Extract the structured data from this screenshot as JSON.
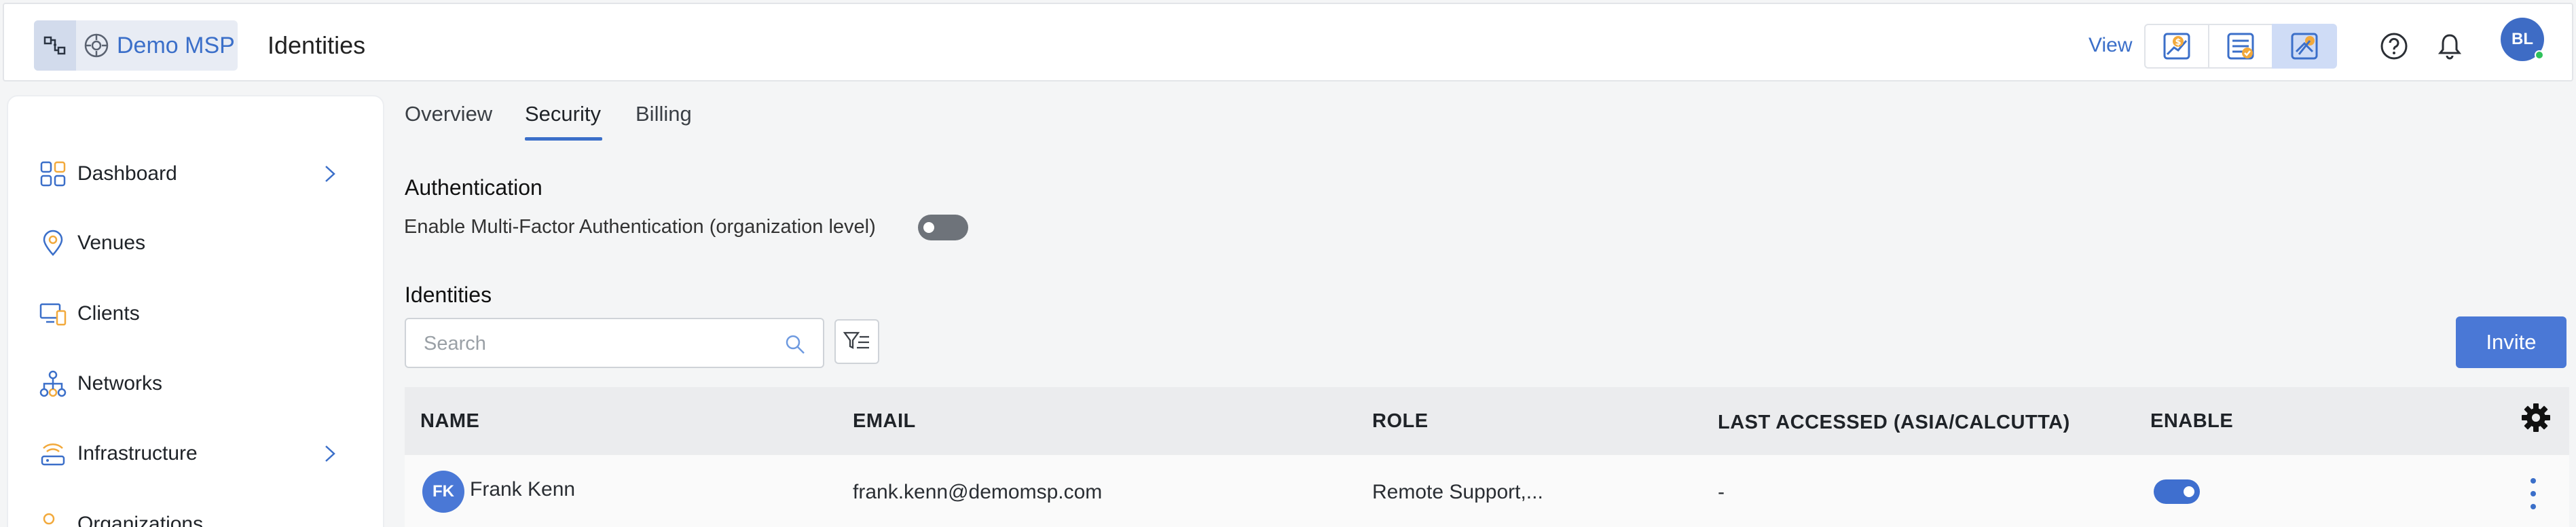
{
  "header": {
    "org_name": "Demo MSP",
    "page_title": "Identities",
    "view_label": "View",
    "avatar_initials": "BL",
    "icons": [
      "network-topology-icon",
      "org-logo-icon",
      "billing-view-icon",
      "checklist-view-icon",
      "support-view-icon",
      "help-icon",
      "bell-icon"
    ]
  },
  "sidebar": {
    "items": [
      {
        "label": "Dashboard",
        "icon": "dashboard-icon",
        "chevron": true
      },
      {
        "label": "Venues",
        "icon": "location-pin-icon",
        "chevron": false
      },
      {
        "label": "Clients",
        "icon": "devices-icon",
        "chevron": false
      },
      {
        "label": "Networks",
        "icon": "network-tree-icon",
        "chevron": false
      },
      {
        "label": "Infrastructure",
        "icon": "wifi-access-point-icon",
        "chevron": true
      },
      {
        "label": "Organizations",
        "icon": "people-icon",
        "chevron": false
      }
    ]
  },
  "tabs": [
    {
      "label": "Overview",
      "active": false
    },
    {
      "label": "Security",
      "active": true
    },
    {
      "label": "Billing",
      "active": false
    }
  ],
  "authentication": {
    "title": "Authentication",
    "mfa_label": "Enable Multi-Factor Authentication (organization level)",
    "mfa_enabled": false
  },
  "identities": {
    "title": "Identities",
    "search_placeholder": "Search",
    "invite_label": "Invite",
    "columns": [
      "NAME",
      "EMAIL",
      "ROLE",
      "LAST ACCESSED (ASIA/CALCUTTA)",
      "ENABLE"
    ],
    "rows": [
      {
        "initials": "FK",
        "name": "Frank Kenn",
        "email": "frank.kenn@demomsp.com",
        "role": "Remote Support,...",
        "last_accessed": "-",
        "enabled": true
      }
    ]
  },
  "colors": {
    "accent": "#3b6fc9",
    "primary_button": "#4a78d6",
    "toggle_off": "#6e737a",
    "online": "#2fc15b"
  }
}
